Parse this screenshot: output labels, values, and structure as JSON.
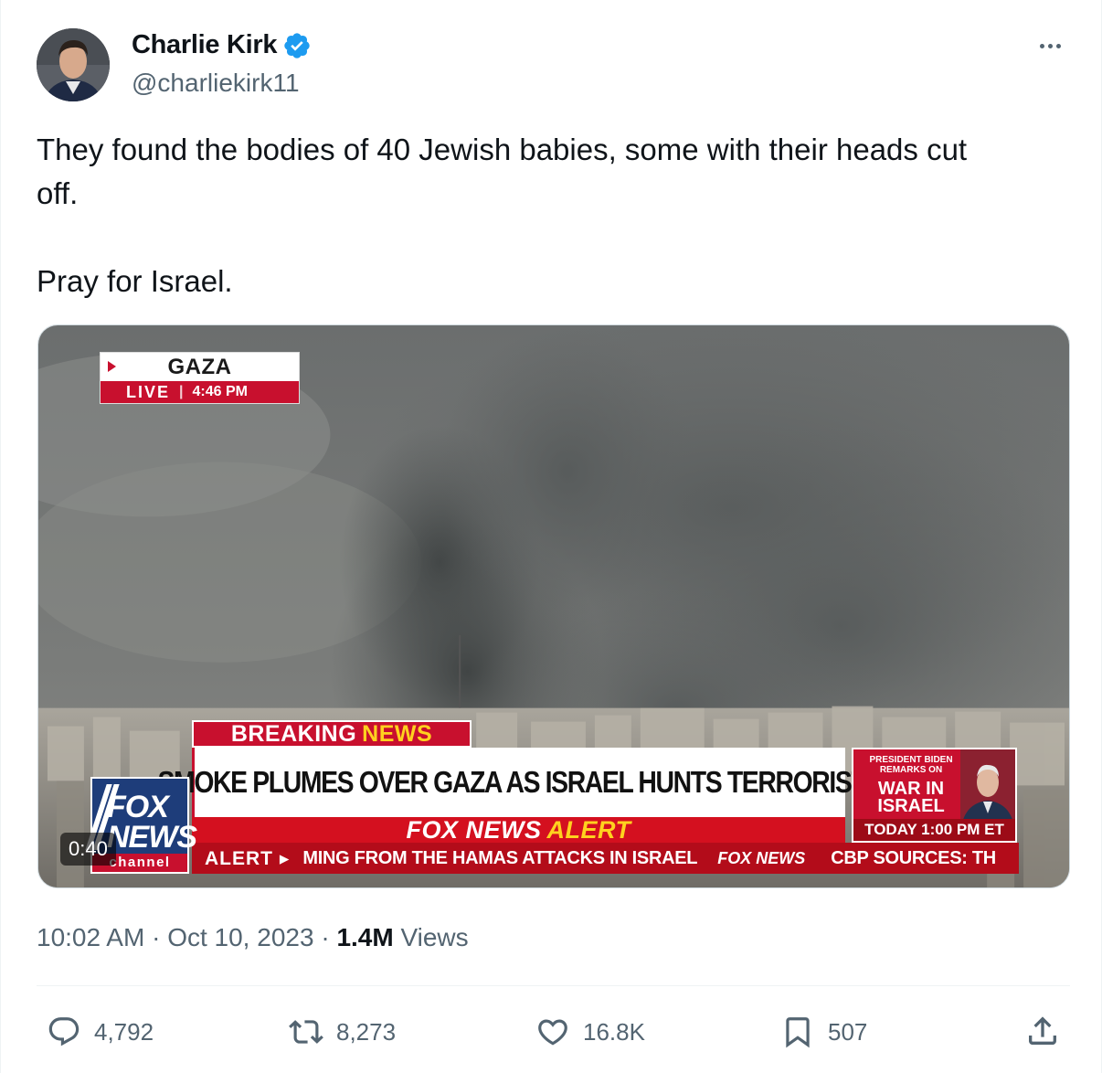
{
  "author": {
    "display_name": "Charlie Kirk",
    "handle": "@charliekirk11",
    "verified": true,
    "verified_color": "#1d9bf0"
  },
  "tweet": {
    "text": "They found the bodies of 40 Jewish babies, some with their heads cut\noff.\n\nPray for Israel."
  },
  "media": {
    "type": "video",
    "duration": "0:40",
    "overlay": {
      "location": "GAZA",
      "live_label": "LIVE",
      "time": "4:46 PM",
      "breaking": "BREAKING",
      "breaking_news": "NEWS",
      "headline": "SMOKE PLUMES OVER GAZA AS ISRAEL HUNTS TERRORISTS",
      "alert_brand": "FOX NEWS",
      "alert_word": "ALERT",
      "ticker_label": "ALERT ▸",
      "ticker_text": "MING FROM THE HAMAS ATTACKS IN ISRAEL",
      "ticker_brand": "FOX NEWS",
      "ticker_text_2": "CBP SOURCES: TH",
      "side_small": "PRESIDENT BIDEN REMARKS ON",
      "side_big": "WAR IN ISRAEL",
      "side_time": "TODAY 1:00 PM ET",
      "logo_top": "FOX",
      "logo_middle": "NEWS",
      "logo_bottom": "channel"
    }
  },
  "meta": {
    "time": "10:02 AM",
    "separator": "·",
    "date": "Oct 10, 2023",
    "views_count": "1.4M",
    "views_label": "Views"
  },
  "actions": {
    "replies": "4,792",
    "reposts": "8,273",
    "likes": "16.8K",
    "bookmarks": "507"
  },
  "icons": {
    "more": "more-icon",
    "reply": "reply-icon",
    "repost": "repost-icon",
    "like": "like-icon",
    "bookmark": "bookmark-icon",
    "share": "share-icon"
  },
  "colors": {
    "text": "#0f1419",
    "secondary": "#536471",
    "fox_red": "#c8102e",
    "fox_blue": "#1e3d7a",
    "fox_yellow": "#ffd21f"
  }
}
